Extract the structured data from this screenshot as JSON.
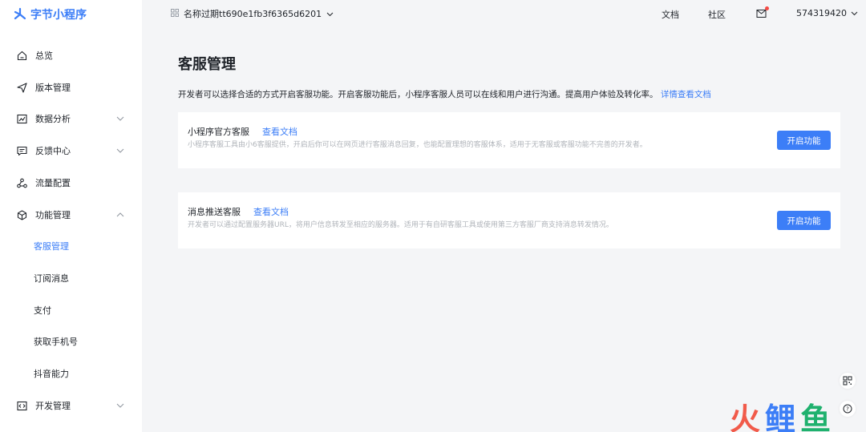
{
  "brand": {
    "name": "字节小程序",
    "color": "#3c7ef7"
  },
  "sidebar": {
    "items": [
      {
        "label": "总览",
        "icon": "home-icon"
      },
      {
        "label": "版本管理",
        "icon": "send-icon"
      },
      {
        "label": "数据分析",
        "icon": "chart-icon",
        "expandable": true,
        "expanded": false
      },
      {
        "label": "反馈中心",
        "icon": "message-icon",
        "expandable": true,
        "expanded": false
      },
      {
        "label": "流量配置",
        "icon": "share-icon"
      },
      {
        "label": "功能管理",
        "icon": "cube-icon",
        "expandable": true,
        "expanded": true
      },
      {
        "label": "开发管理",
        "icon": "code-icon",
        "expandable": true,
        "expanded": false
      }
    ],
    "sub_items": [
      {
        "label": "客服管理",
        "active": true
      },
      {
        "label": "订阅消息",
        "active": false
      },
      {
        "label": "支付",
        "active": false
      },
      {
        "label": "获取手机号",
        "active": false
      },
      {
        "label": "抖音能力",
        "active": false
      }
    ]
  },
  "topbar": {
    "app_name": "名称过期tt690e1fb3f6365d6201",
    "docs": "文档",
    "community": "社区",
    "user_id": "574319420"
  },
  "main": {
    "title": "客服管理",
    "intro": "开发者可以选择合适的方式开启客服功能。开启客服功能后，小程序客服人员可以在线和用户进行沟通。提高用户体验及转化率。",
    "intro_link": "详情查看文档",
    "cards": [
      {
        "title": "小程序官方客服",
        "link": "查看文档",
        "desc": "小程序客服工具由小6客服提供，开启后你可以在网页进行客服消息回复，也能配置理想的客服体系，适用于无客服或客服功能不完善的开发者。",
        "button": "开启功能"
      },
      {
        "title": "消息推送客服",
        "link": "查看文档",
        "desc": "开发者可以通过配置服务器URL，将用户信息转发至相应的服务器。适用于有自研客服工具或使用第三方客服厂商支持消息转发情况。",
        "button": "开启功能"
      }
    ]
  },
  "watermark": {
    "chars": [
      "火",
      "鲤",
      "鱼"
    ],
    "colors": [
      "#f15a4a",
      "#3c7ef7",
      "#1fb16e"
    ]
  }
}
